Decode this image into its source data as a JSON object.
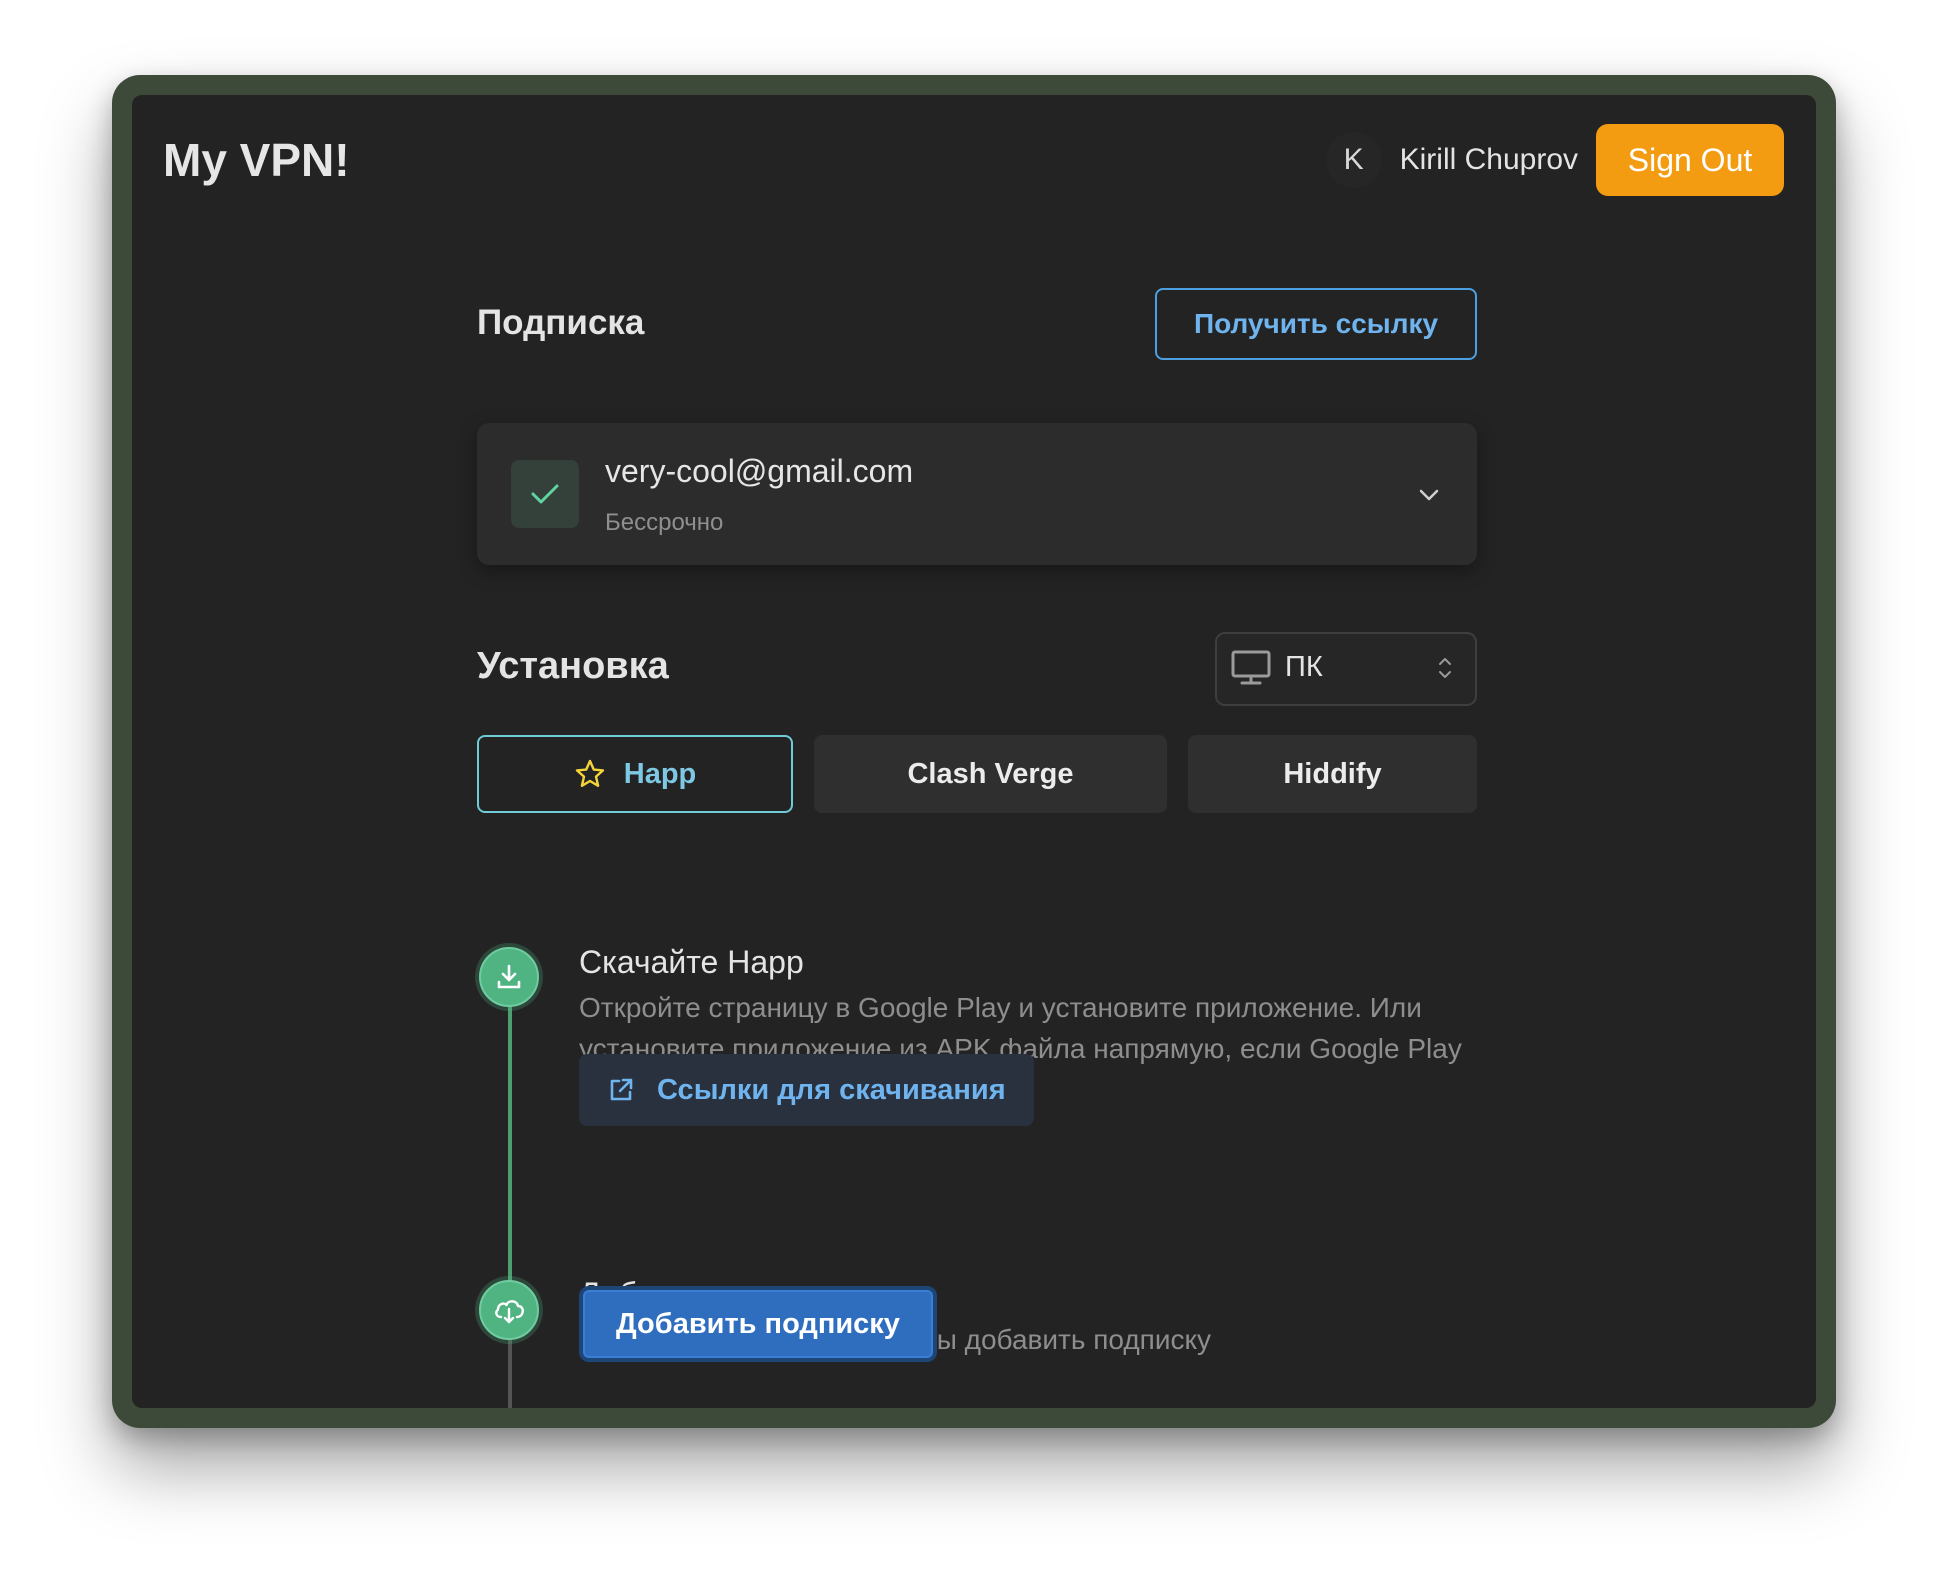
{
  "app": {
    "title": "My VPN!"
  },
  "header": {
    "avatar_initial": "K",
    "user_name": "Kirill Chuprov",
    "sign_out_label": "Sign Out"
  },
  "subscription": {
    "title": "Подписка",
    "get_link_label": "Получить ссылку",
    "card": {
      "email": "very-cool@gmail.com",
      "term": "Бессрочно"
    }
  },
  "installation": {
    "title": "Установка",
    "platform": {
      "selected": "ПК"
    },
    "tabs": [
      {
        "label": "Happ",
        "active": true
      },
      {
        "label": "Clash Verge",
        "active": false
      },
      {
        "label": "Hiddify",
        "active": false
      }
    ],
    "steps": [
      {
        "title": "Скачайте Happ",
        "description": "Откройте страницу в Google Play и установите приложение. Или установите приложение из APK файла напрямую, если Google Play не работает.",
        "button_label": "Ссылки для скачивания"
      },
      {
        "title": "Добавить подписку",
        "description": "Нажмите кнопку ниже, чтобы добавить подписку",
        "button_label": "Добавить подписку"
      }
    ]
  },
  "colors": {
    "accent_orange": "#f39c12",
    "accent_blue": "#4d9fe0",
    "step_green": "#4fb482",
    "primary_button": "#2f6dbf",
    "background": "#232323"
  },
  "icons": {
    "check": "check-icon",
    "chevron": "chevron-down-icon",
    "platform": "monitor-icon",
    "select_arrows": "select-arrows-icon",
    "star": "star-icon",
    "step1": "download-icon",
    "step2": "cloud-download-icon",
    "external": "external-link-icon"
  }
}
